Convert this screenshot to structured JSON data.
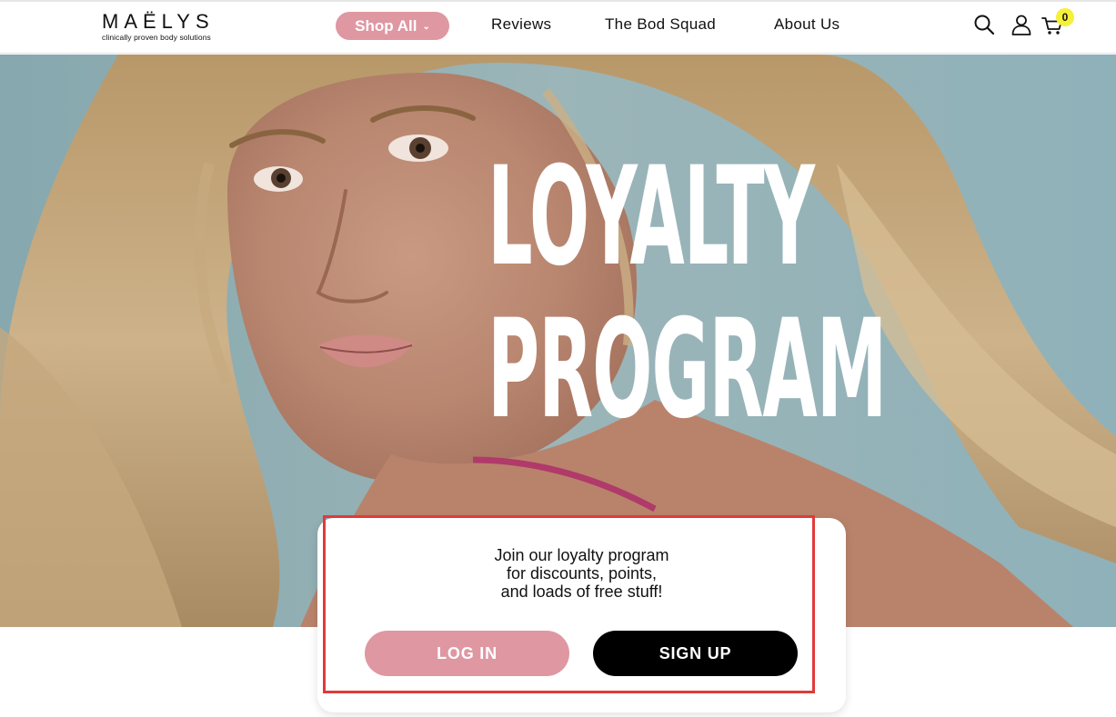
{
  "brand": {
    "name": "MAËLYS",
    "tagline": "clinically proven body solutions"
  },
  "nav": {
    "shop_all": "Shop All",
    "shop_all_chevron": "⌄",
    "reviews": "Reviews",
    "bod_squad": "The Bod Squad",
    "about": "About Us"
  },
  "header_icons": {
    "search": "search-icon",
    "account": "user-icon",
    "cart": "cart-icon",
    "cart_count": "0"
  },
  "hero": {
    "title_line1": "LOYALTY",
    "title_line2": "PROGRAM"
  },
  "card": {
    "line1": "Join our loyalty program",
    "line2": "for discounts, points,",
    "line3": "and loads of free stuff!",
    "login_label": "LOG IN",
    "signup_label": "SIGN UP"
  },
  "colors": {
    "accent_pink": "#df97a2",
    "badge_yellow": "#f5f03a",
    "highlight_red": "#e03a3a",
    "signup_black": "#000000"
  }
}
